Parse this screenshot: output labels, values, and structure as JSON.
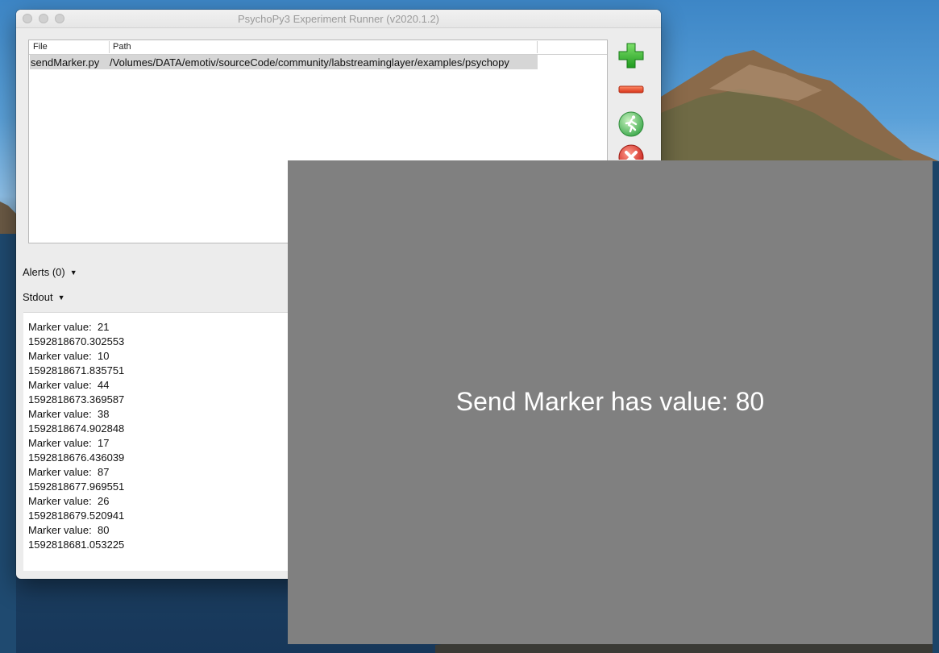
{
  "window": {
    "title": "PsychoPy3 Experiment Runner (v2020.1.2)"
  },
  "file_list": {
    "columns": [
      "File",
      "Path"
    ],
    "rows": [
      {
        "file": "sendMarker.py",
        "path": "/Volumes/DATA/emotiv/sourceCode/community/labstreaminglayer/examples/psychopy"
      }
    ]
  },
  "toolbar": {
    "add_icon": "plus-icon",
    "remove_icon": "minus-icon",
    "run_icon": "run-icon",
    "stop_icon": "stop-icon"
  },
  "sections": {
    "alerts_label": "Alerts (0)",
    "stdout_label": "Stdout"
  },
  "stdout": {
    "lines": [
      "Marker value:  21",
      "1592818670.302553",
      "Marker value:  10",
      "1592818671.835751",
      "Marker value:  44",
      "1592818673.369587",
      "Marker value:  38",
      "1592818674.902848",
      "Marker value:  17",
      "1592818676.436039",
      "Marker value:  87",
      "1592818677.969551",
      "Marker value:  26",
      "1592818679.520941",
      "Marker value:  80",
      "1592818681.053225"
    ]
  },
  "stimulus": {
    "text": "Send Marker has value: 80",
    "background": "#808080",
    "color": "#ffffff"
  }
}
